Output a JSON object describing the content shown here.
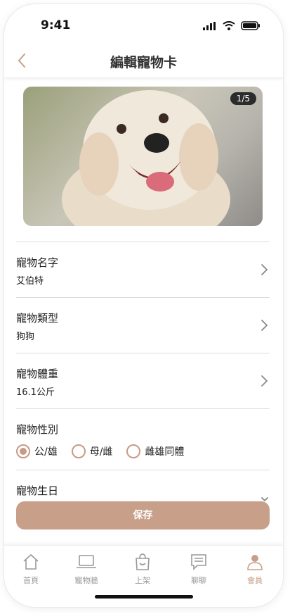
{
  "status_bar": {
    "time": "9:41"
  },
  "header": {
    "title": "編輯寵物卡",
    "back_icon": "chevron-left-icon"
  },
  "photo": {
    "pager": "1/5"
  },
  "fields": {
    "name": {
      "label": "寵物名字",
      "value": "艾伯特"
    },
    "type": {
      "label": "寵物類型",
      "value": "狗狗"
    },
    "weight": {
      "label": "寵物體重",
      "value": "16.1公斤"
    },
    "gender": {
      "label": "寵物性別",
      "options": [
        "公/雄",
        "母/雌",
        "雌雄同體"
      ],
      "selected": "公/雄"
    },
    "birthday": {
      "label": "寵物生日"
    }
  },
  "save_button": {
    "label": "保存"
  },
  "tabbar": {
    "items": [
      {
        "label": "首頁",
        "icon": "home-icon"
      },
      {
        "label": "寵物牆",
        "icon": "laptop-icon"
      },
      {
        "label": "上架",
        "icon": "bag-icon"
      },
      {
        "label": "聊聊",
        "icon": "chat-icon"
      },
      {
        "label": "會員",
        "icon": "user-icon"
      }
    ],
    "active": "會員"
  },
  "colors": {
    "accent": "#c8a08a",
    "radio": "#c69c86"
  }
}
